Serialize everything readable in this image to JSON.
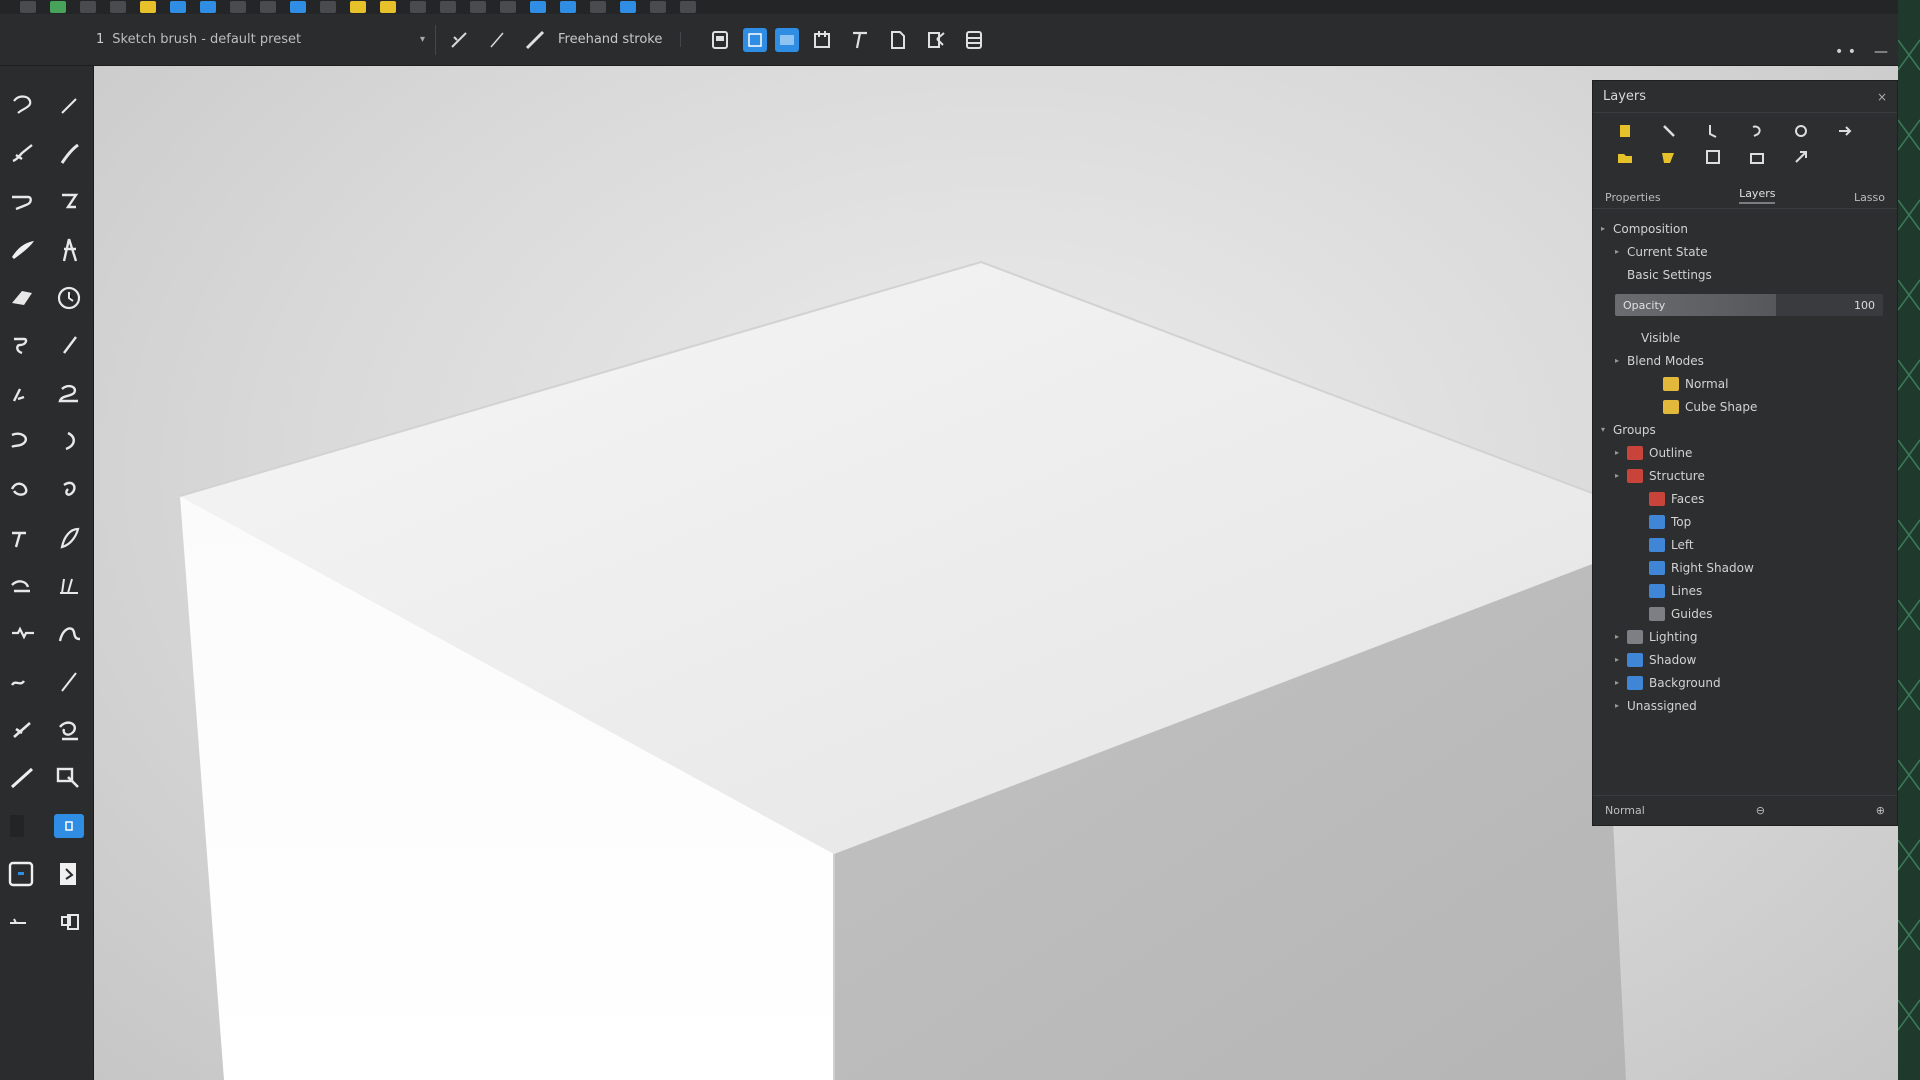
{
  "menubar": {
    "icon_count": 28
  },
  "options_bar": {
    "preset_number": "1",
    "preset_name": "Sketch brush - default preset",
    "mode_label": "Freehand stroke",
    "tool_buttons": [
      "line-icon",
      "line-thin-icon",
      "line-thick-icon",
      "page-icon",
      "layer-blue-icon",
      "layer-blue-2-icon",
      "frame-icon",
      "text-icon",
      "document-icon",
      "transform-icon",
      "stack-icon"
    ]
  },
  "window_controls": {
    "more": "• •",
    "minimize": "—"
  },
  "toolbox": {
    "tools": [
      "lasso-icon",
      "pencil-icon",
      "brush-icon",
      "ink-pen-icon",
      "curve-icon",
      "hook-icon",
      "calligraphy-icon",
      "figure-icon",
      "eraser-icon",
      "rotate-icon",
      "smudge-icon",
      "marker-icon",
      "airbrush-icon",
      "blend-icon",
      "fill-icon",
      "arc-icon",
      "shape-icon",
      "spiral-icon",
      "rope-icon",
      "leaf-pen-icon",
      "texture-icon",
      "pattern-icon",
      "stamp-icon",
      "flow-icon",
      "wave-icon",
      "slash-icon",
      "ruler-icon",
      "dodge-icon",
      "line-tool-icon",
      "select-icon",
      "hand-icon",
      "selected-swatch-icon",
      "frame-tool-icon",
      "paper-icon",
      "misc-icon",
      "link-icon"
    ]
  },
  "panel": {
    "title": "Layers",
    "close": "×",
    "tabs": [
      "Layers",
      "Lasso"
    ],
    "section_label": "Properties",
    "opacity_label": "Opacity",
    "opacity_value": "100",
    "opacity_fraction": 0.6,
    "rows": [
      {
        "indent": 0,
        "twisty": "▸",
        "icon": "",
        "label": "Composition"
      },
      {
        "indent": 1,
        "twisty": "▸",
        "icon": "",
        "label": "Current State"
      },
      {
        "indent": 1,
        "twisty": "",
        "icon": "",
        "label": "Basic Settings"
      },
      {
        "indent": 2,
        "twisty": "",
        "icon": "",
        "label": "Visible"
      },
      {
        "indent": 1,
        "twisty": "▸",
        "icon": "",
        "label": "Blend Modes"
      },
      {
        "indent": 3,
        "twisty": "",
        "icon": "y",
        "label": "Normal"
      },
      {
        "indent": 3,
        "twisty": "",
        "icon": "y",
        "label": "Cube Shape"
      },
      {
        "indent": 0,
        "twisty": "▾",
        "icon": "",
        "label": "Groups"
      },
      {
        "indent": 1,
        "twisty": "▸",
        "icon": "r",
        "label": "Outline"
      },
      {
        "indent": 1,
        "twisty": "▸",
        "icon": "r",
        "label": "Structure"
      },
      {
        "indent": 2,
        "twisty": "",
        "icon": "r",
        "label": "Faces"
      },
      {
        "indent": 2,
        "twisty": "",
        "icon": "bl",
        "label": "Top"
      },
      {
        "indent": 2,
        "twisty": "",
        "icon": "bl",
        "label": "Left"
      },
      {
        "indent": 2,
        "twisty": "",
        "icon": "bl",
        "label": "Right Shadow"
      },
      {
        "indent": 2,
        "twisty": "",
        "icon": "bl",
        "label": "Lines"
      },
      {
        "indent": 2,
        "twisty": "",
        "icon": "gr",
        "label": "Guides"
      },
      {
        "indent": 1,
        "twisty": "▸",
        "icon": "gr",
        "label": "Lighting"
      },
      {
        "indent": 1,
        "twisty": "▸",
        "icon": "bl",
        "label": "Shadow"
      },
      {
        "indent": 1,
        "twisty": "▸",
        "icon": "bl",
        "label": "Background"
      },
      {
        "indent": 1,
        "twisty": "▸",
        "icon": "",
        "label": "Unassigned"
      }
    ],
    "footer_left": "Normal",
    "footer_mid": "⊖",
    "footer_right": "⊕"
  },
  "colors": {
    "accent": "#2f8de4",
    "highlight": "#e6c12a",
    "panel_bg": "#2d2e30"
  }
}
